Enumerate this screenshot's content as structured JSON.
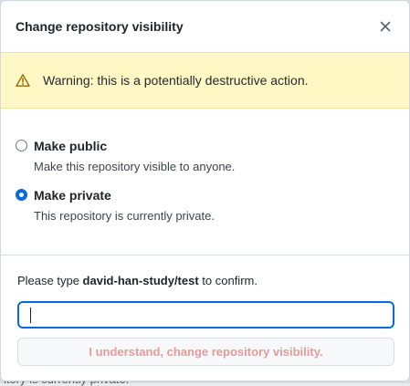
{
  "dialog": {
    "title": "Change repository visibility",
    "close_icon": "x-icon"
  },
  "warning": {
    "icon": "alert-triangle-icon",
    "text": "Warning: this is a potentially destructive action."
  },
  "options": [
    {
      "label": "Make public",
      "note": "Make this repository visible to anyone.",
      "checked": false
    },
    {
      "label": "Make private",
      "note": "This repository is currently private.",
      "checked": true
    }
  ],
  "confirm": {
    "prefix": "Please type ",
    "repo": "david-han-study/test",
    "suffix": " to confirm.",
    "input_value": "",
    "button_label": "I understand, change repository visibility."
  },
  "backdrop": {
    "text": "itory is currently private."
  },
  "colors": {
    "accent": "#0969da",
    "warning_bg": "#fff8c5",
    "warning_icon": "#9a6700",
    "danger_disabled_text": "#e49a9a"
  }
}
